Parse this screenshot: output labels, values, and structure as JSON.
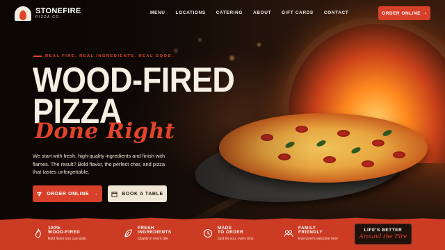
{
  "brand": {
    "name": "STONEFIRE",
    "sub": "PIZZA CO."
  },
  "nav": {
    "items": [
      "MENU",
      "LOCATIONS",
      "CATERING",
      "ABOUT",
      "GIFT CARDS",
      "CONTACT"
    ],
    "cta": "ORDER ONLINE",
    "cta_icon": "chevron-right-icon"
  },
  "hero": {
    "tagline": "REAL FIRE. REAL INGREDIENTS. REAL GOOD.",
    "title_line1": "WOOD-FIRED",
    "title_line2": "PIZZA",
    "script": "Done Right",
    "description": "We start with fresh, high-quality ingredients and finish with flames. The result? Bold flavor, the perfect char, and pizza that tastes unforgettable.",
    "primary_button": "ORDER ONLINE",
    "secondary_button": "BOOK A TABLE"
  },
  "features": [
    {
      "icon": "flame-icon",
      "line1": "100%",
      "line2": "WOOD-FIRED",
      "line3": "Bold flavor you can taste"
    },
    {
      "icon": "leaf-icon",
      "line1": "FRESH",
      "line2": "INGREDIENTS",
      "line3": "Quality in every bite"
    },
    {
      "icon": "clock-icon",
      "line1": "MADE",
      "line2": "TO ORDER",
      "line3": "Just for you, every time"
    },
    {
      "icon": "family-icon",
      "line1": "FAMILY",
      "line2": "FRIENDLY",
      "line3": "Everyone's welcome here"
    }
  ],
  "badge": {
    "line1": "LIFE'S BETTER",
    "line2": "Around the Fire"
  },
  "colors": {
    "accent": "#d8402a",
    "cream": "#f1e7d6",
    "dark": "#1a0f0a"
  }
}
